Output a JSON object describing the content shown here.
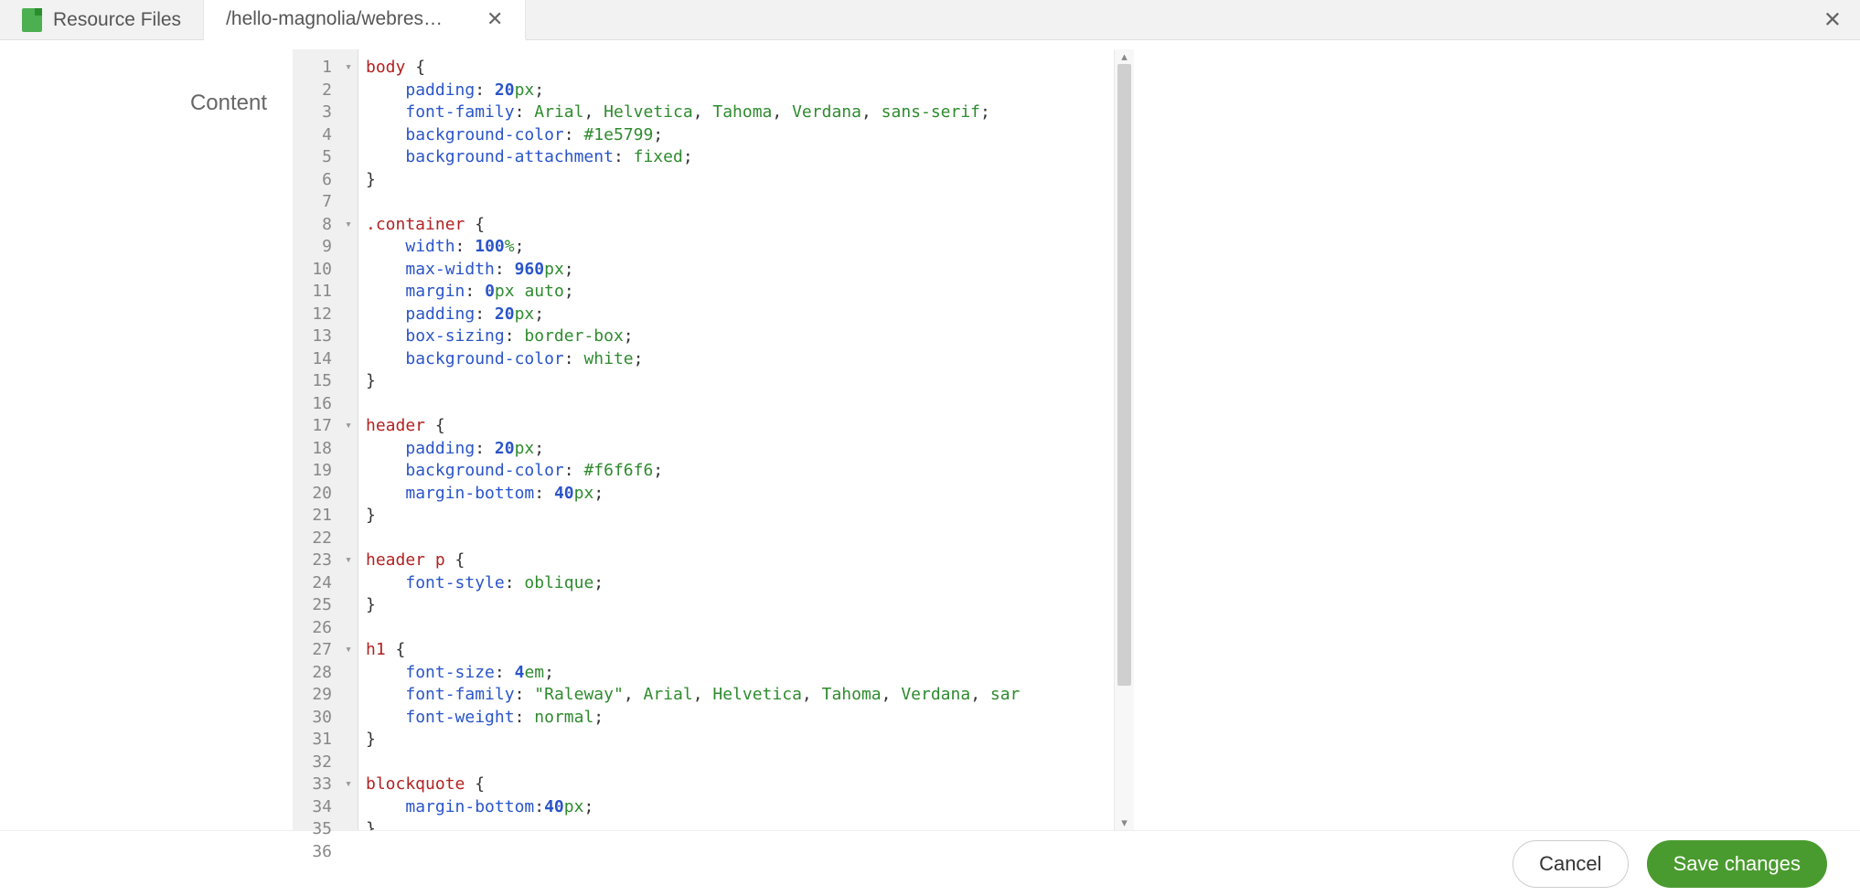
{
  "tabs": {
    "inactive_label": "Resource Files",
    "active_label": "/hello-magnolia/webres…"
  },
  "form": {
    "content_label": "Content"
  },
  "buttons": {
    "cancel": "Cancel",
    "save": "Save changes"
  },
  "editor": {
    "lines": [
      {
        "n": 1,
        "fold": true,
        "tokens": [
          [
            "sel",
            "body"
          ],
          [
            "pn",
            " {"
          ]
        ]
      },
      {
        "n": 2,
        "tokens": [
          [
            "pn",
            "    "
          ],
          [
            "prop",
            "padding"
          ],
          [
            "pn",
            ": "
          ],
          [
            "num",
            "20"
          ],
          [
            "unit",
            "px"
          ],
          [
            "pn",
            ";"
          ]
        ]
      },
      {
        "n": 3,
        "tokens": [
          [
            "pn",
            "    "
          ],
          [
            "prop",
            "font-family"
          ],
          [
            "pn",
            ": "
          ],
          [
            "val",
            "Arial"
          ],
          [
            "pn",
            ", "
          ],
          [
            "val",
            "Helvetica"
          ],
          [
            "pn",
            ", "
          ],
          [
            "val",
            "Tahoma"
          ],
          [
            "pn",
            ", "
          ],
          [
            "val",
            "Verdana"
          ],
          [
            "pn",
            ", "
          ],
          [
            "val",
            "sans-serif"
          ],
          [
            "pn",
            ";"
          ]
        ]
      },
      {
        "n": 4,
        "tokens": [
          [
            "pn",
            "    "
          ],
          [
            "prop",
            "background-color"
          ],
          [
            "pn",
            ": "
          ],
          [
            "val",
            "#1e5799"
          ],
          [
            "pn",
            ";"
          ]
        ]
      },
      {
        "n": 5,
        "tokens": [
          [
            "pn",
            "    "
          ],
          [
            "prop",
            "background-attachment"
          ],
          [
            "pn",
            ": "
          ],
          [
            "val",
            "fixed"
          ],
          [
            "pn",
            ";"
          ]
        ]
      },
      {
        "n": 6,
        "tokens": [
          [
            "pn",
            "}"
          ]
        ]
      },
      {
        "n": 7,
        "tokens": []
      },
      {
        "n": 8,
        "fold": true,
        "tokens": [
          [
            "sel",
            ".container"
          ],
          [
            "pn",
            " {"
          ]
        ]
      },
      {
        "n": 9,
        "tokens": [
          [
            "pn",
            "    "
          ],
          [
            "prop",
            "width"
          ],
          [
            "pn",
            ": "
          ],
          [
            "num",
            "100"
          ],
          [
            "unit",
            "%"
          ],
          [
            "pn",
            ";"
          ]
        ]
      },
      {
        "n": 10,
        "tokens": [
          [
            "pn",
            "    "
          ],
          [
            "prop",
            "max-width"
          ],
          [
            "pn",
            ": "
          ],
          [
            "num",
            "960"
          ],
          [
            "unit",
            "px"
          ],
          [
            "pn",
            ";"
          ]
        ]
      },
      {
        "n": 11,
        "tokens": [
          [
            "pn",
            "    "
          ],
          [
            "prop",
            "margin"
          ],
          [
            "pn",
            ": "
          ],
          [
            "num",
            "0"
          ],
          [
            "unit",
            "px"
          ],
          [
            "pn",
            " "
          ],
          [
            "val",
            "auto"
          ],
          [
            "pn",
            ";"
          ]
        ]
      },
      {
        "n": 12,
        "tokens": [
          [
            "pn",
            "    "
          ],
          [
            "prop",
            "padding"
          ],
          [
            "pn",
            ": "
          ],
          [
            "num",
            "20"
          ],
          [
            "unit",
            "px"
          ],
          [
            "pn",
            ";"
          ]
        ]
      },
      {
        "n": 13,
        "tokens": [
          [
            "pn",
            "    "
          ],
          [
            "prop",
            "box-sizing"
          ],
          [
            "pn",
            ": "
          ],
          [
            "val",
            "border-box"
          ],
          [
            "pn",
            ";"
          ]
        ]
      },
      {
        "n": 14,
        "tokens": [
          [
            "pn",
            "    "
          ],
          [
            "prop",
            "background-color"
          ],
          [
            "pn",
            ": "
          ],
          [
            "val",
            "white"
          ],
          [
            "pn",
            ";"
          ]
        ]
      },
      {
        "n": 15,
        "tokens": [
          [
            "pn",
            "}"
          ]
        ]
      },
      {
        "n": 16,
        "tokens": []
      },
      {
        "n": 17,
        "fold": true,
        "tokens": [
          [
            "sel",
            "header"
          ],
          [
            "pn",
            " {"
          ]
        ]
      },
      {
        "n": 18,
        "tokens": [
          [
            "pn",
            "    "
          ],
          [
            "prop",
            "padding"
          ],
          [
            "pn",
            ": "
          ],
          [
            "num",
            "20"
          ],
          [
            "unit",
            "px"
          ],
          [
            "pn",
            ";"
          ]
        ]
      },
      {
        "n": 19,
        "tokens": [
          [
            "pn",
            "    "
          ],
          [
            "prop",
            "background-color"
          ],
          [
            "pn",
            ": "
          ],
          [
            "val",
            "#f6f6f6"
          ],
          [
            "pn",
            ";"
          ]
        ]
      },
      {
        "n": 20,
        "tokens": [
          [
            "pn",
            "    "
          ],
          [
            "prop",
            "margin-bottom"
          ],
          [
            "pn",
            ": "
          ],
          [
            "num",
            "40"
          ],
          [
            "unit",
            "px"
          ],
          [
            "pn",
            ";"
          ]
        ]
      },
      {
        "n": 21,
        "tokens": [
          [
            "pn",
            "}"
          ]
        ]
      },
      {
        "n": 22,
        "tokens": []
      },
      {
        "n": 23,
        "fold": true,
        "tokens": [
          [
            "sel",
            "header p"
          ],
          [
            "pn",
            " {"
          ]
        ]
      },
      {
        "n": 24,
        "tokens": [
          [
            "pn",
            "    "
          ],
          [
            "prop",
            "font-style"
          ],
          [
            "pn",
            ": "
          ],
          [
            "val",
            "oblique"
          ],
          [
            "pn",
            ";"
          ]
        ]
      },
      {
        "n": 25,
        "tokens": [
          [
            "pn",
            "}"
          ]
        ]
      },
      {
        "n": 26,
        "tokens": []
      },
      {
        "n": 27,
        "fold": true,
        "tokens": [
          [
            "sel",
            "h1"
          ],
          [
            "pn",
            " {"
          ]
        ]
      },
      {
        "n": 28,
        "tokens": [
          [
            "pn",
            "    "
          ],
          [
            "prop",
            "font-size"
          ],
          [
            "pn",
            ": "
          ],
          [
            "num",
            "4"
          ],
          [
            "unit",
            "em"
          ],
          [
            "pn",
            ";"
          ]
        ]
      },
      {
        "n": 29,
        "tokens": [
          [
            "pn",
            "    "
          ],
          [
            "prop",
            "font-family"
          ],
          [
            "pn",
            ": "
          ],
          [
            "str",
            "\"Raleway\""
          ],
          [
            "pn",
            ", "
          ],
          [
            "val",
            "Arial"
          ],
          [
            "pn",
            ", "
          ],
          [
            "val",
            "Helvetica"
          ],
          [
            "pn",
            ", "
          ],
          [
            "val",
            "Tahoma"
          ],
          [
            "pn",
            ", "
          ],
          [
            "val",
            "Verdana"
          ],
          [
            "pn",
            ", "
          ],
          [
            "val",
            "sar"
          ]
        ]
      },
      {
        "n": 30,
        "tokens": [
          [
            "pn",
            "    "
          ],
          [
            "prop",
            "font-weight"
          ],
          [
            "pn",
            ": "
          ],
          [
            "val",
            "normal"
          ],
          [
            "pn",
            ";"
          ]
        ]
      },
      {
        "n": 31,
        "tokens": [
          [
            "pn",
            "}"
          ]
        ]
      },
      {
        "n": 32,
        "tokens": []
      },
      {
        "n": 33,
        "fold": true,
        "tokens": [
          [
            "sel",
            "blockquote"
          ],
          [
            "pn",
            " {"
          ]
        ]
      },
      {
        "n": 34,
        "tokens": [
          [
            "pn",
            "    "
          ],
          [
            "prop",
            "margin-bottom"
          ],
          [
            "pn",
            ":"
          ],
          [
            "num",
            "40"
          ],
          [
            "unit",
            "px"
          ],
          [
            "pn",
            ";"
          ]
        ]
      },
      {
        "n": 35,
        "tokens": [
          [
            "pn",
            "}"
          ]
        ]
      },
      {
        "n": 36,
        "tokens": []
      }
    ]
  }
}
